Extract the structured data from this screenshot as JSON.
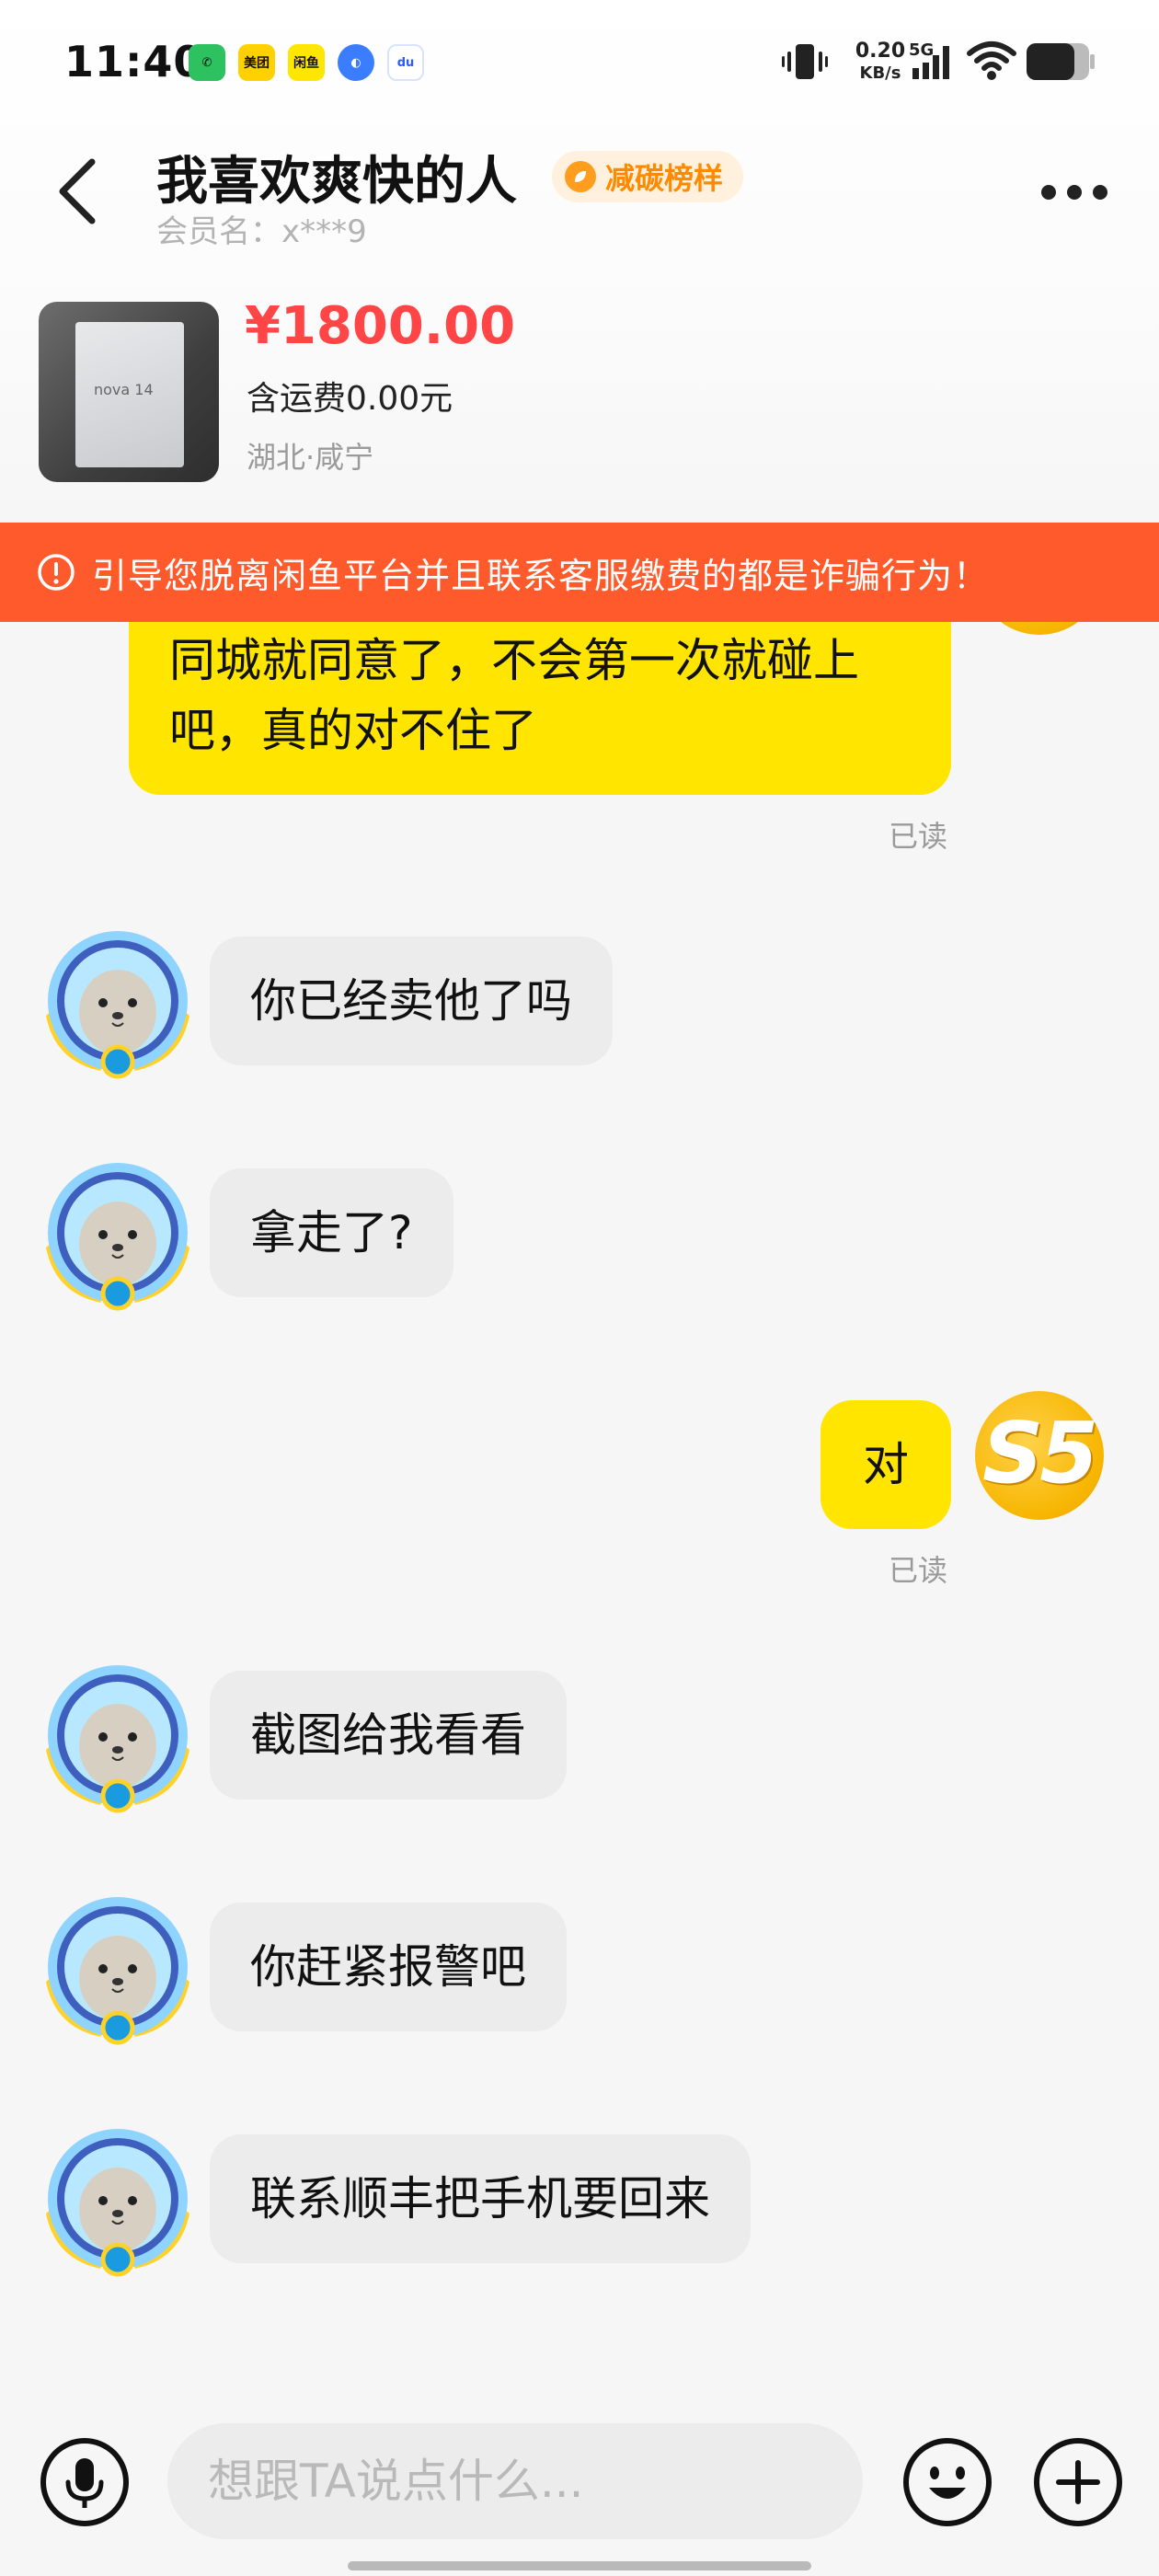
{
  "status_bar": {
    "time": "11:40",
    "apps": [
      {
        "name": "wechat",
        "glyph": "✆"
      },
      {
        "name": "meituan",
        "glyph": "美团"
      },
      {
        "name": "xianyu",
        "glyph": "闲鱼"
      },
      {
        "name": "browser",
        "glyph": "◐"
      },
      {
        "name": "baidu",
        "glyph": "du"
      }
    ],
    "net_speed": "0.20",
    "net_unit": "KB/s",
    "network_type": "5G"
  },
  "header": {
    "title": "我喜欢爽快的人",
    "badge": "减碳榜样",
    "member_name": "会员名：x***9"
  },
  "product": {
    "price": "¥1800.00",
    "shipping": "含运费0.00元",
    "location": "湖北·咸宁",
    "thumb_label": "nova 14"
  },
  "warning": {
    "text": "引导您脱离闲鱼平台并且联系客服缴费的都是诈骗行为！"
  },
  "messages": [
    {
      "sender": "me",
      "text": "同城就同意了，不会第一次就碰上吧，真的对不住了",
      "read": "已读"
    },
    {
      "sender": "other",
      "text": "你已经卖他了吗"
    },
    {
      "sender": "other",
      "text": "拿走了?"
    },
    {
      "sender": "me",
      "text": "对",
      "read": "已读"
    },
    {
      "sender": "other",
      "text": "截图给我看看"
    },
    {
      "sender": "other",
      "text": "你赶紧报警吧"
    },
    {
      "sender": "other",
      "text": "联系顺丰把手机要回来"
    }
  ],
  "self_avatar_text": "S5",
  "input": {
    "placeholder": "想跟TA说点什么..."
  },
  "colors": {
    "accent_yellow": "#ffe500",
    "price_red": "#ff4545",
    "warning_orange": "#ff5a2c",
    "badge_orange": "#ff8a00"
  }
}
